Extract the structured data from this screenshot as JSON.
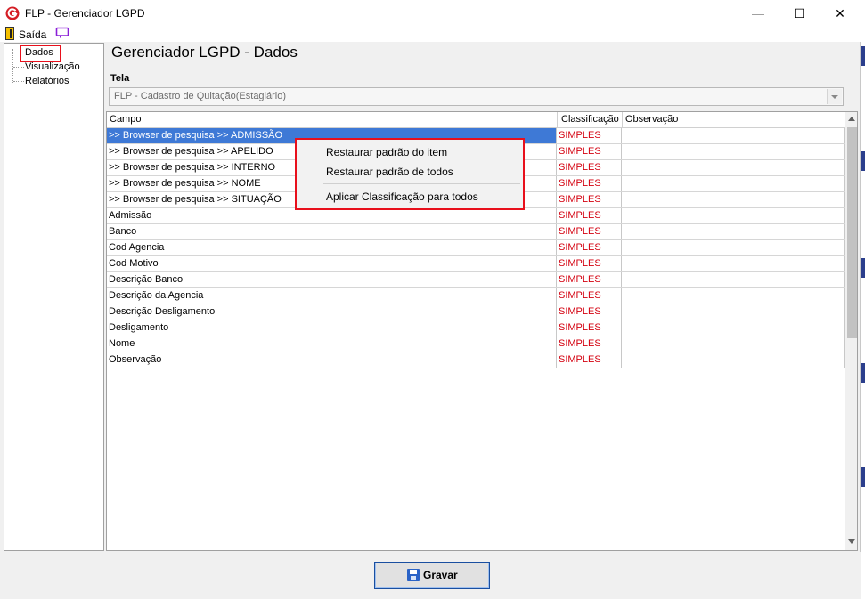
{
  "window": {
    "title": "FLP - Gerenciador LGPD",
    "minimize_glyph": "—",
    "maximize_glyph": "☐",
    "close_glyph": "✕"
  },
  "menu": {
    "exit_label": "Saída"
  },
  "tree": {
    "items": [
      {
        "label": "Dados"
      },
      {
        "label": "Visualização"
      },
      {
        "label": "Relatórios"
      }
    ]
  },
  "main": {
    "title": "Gerenciador LGPD - Dados",
    "tela_label": "Tela",
    "tela_value": "FLP - Cadastro de Quitação(Estagiário)"
  },
  "grid": {
    "columns": [
      "Campo",
      "Classificação",
      "Observação"
    ],
    "rows": [
      {
        "campo": ">> Browser de pesquisa >> ADMISSÃO",
        "classificacao": "SIMPLES",
        "observacao": ""
      },
      {
        "campo": ">> Browser de pesquisa >> APELIDO",
        "classificacao": "SIMPLES",
        "observacao": ""
      },
      {
        "campo": ">> Browser de pesquisa >> INTERNO",
        "classificacao": "SIMPLES",
        "observacao": ""
      },
      {
        "campo": ">> Browser de pesquisa >> NOME",
        "classificacao": "SIMPLES",
        "observacao": ""
      },
      {
        "campo": ">> Browser de pesquisa >> SITUAÇÃO",
        "classificacao": "SIMPLES",
        "observacao": ""
      },
      {
        "campo": "Admissão",
        "classificacao": "SIMPLES",
        "observacao": ""
      },
      {
        "campo": "Banco",
        "classificacao": "SIMPLES",
        "observacao": ""
      },
      {
        "campo": "Cod Agencia",
        "classificacao": "SIMPLES",
        "observacao": ""
      },
      {
        "campo": "Cod Motivo",
        "classificacao": "SIMPLES",
        "observacao": ""
      },
      {
        "campo": "Descrição Banco",
        "classificacao": "SIMPLES",
        "observacao": ""
      },
      {
        "campo": "Descrição da Agencia",
        "classificacao": "SIMPLES",
        "observacao": ""
      },
      {
        "campo": "Descrição Desligamento",
        "classificacao": "SIMPLES",
        "observacao": ""
      },
      {
        "campo": "Desligamento",
        "classificacao": "SIMPLES",
        "observacao": ""
      },
      {
        "campo": "Nome",
        "classificacao": "SIMPLES",
        "observacao": ""
      },
      {
        "campo": "Observação",
        "classificacao": "SIMPLES",
        "observacao": ""
      }
    ]
  },
  "context_menu": {
    "items": [
      "Restaurar padrão do item",
      "Restaurar padrão de todos",
      "Aplicar Classificação para todos"
    ]
  },
  "footer": {
    "save_label": "Gravar"
  },
  "colors": {
    "selection": "#3e79d6",
    "classification_text": "#d4000f",
    "highlight_box": "#e8101c"
  }
}
